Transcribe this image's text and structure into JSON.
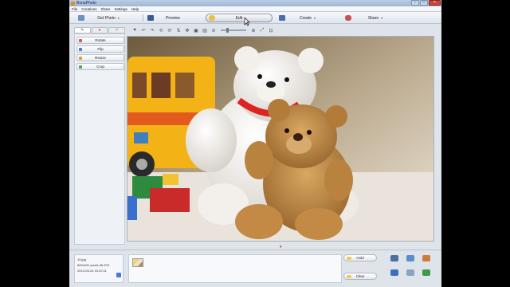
{
  "window": {
    "title": "BonaPhoto"
  },
  "menu": [
    "File",
    "Creations",
    "Share",
    "Settings",
    "Help"
  ],
  "modes": {
    "get_photo": "Get Photo",
    "preview": "Preview",
    "edit": "Edit",
    "create": "Create",
    "share": "Share"
  },
  "edit_tools": {
    "rotate": "Rotate",
    "flip": "Flip",
    "resize": "Resize",
    "crop": "Crop"
  },
  "file_info": {
    "name": "19.jpg",
    "details": "800x531 pixels 66.87K",
    "date": "2013-05-24 15:22:11"
  },
  "tray": {
    "hold": "Hold",
    "clear": "Clear"
  },
  "colors": {
    "accent": "#4a7bd0",
    "title_bar": "#9fb6d4",
    "close_button": "#c9453a"
  }
}
